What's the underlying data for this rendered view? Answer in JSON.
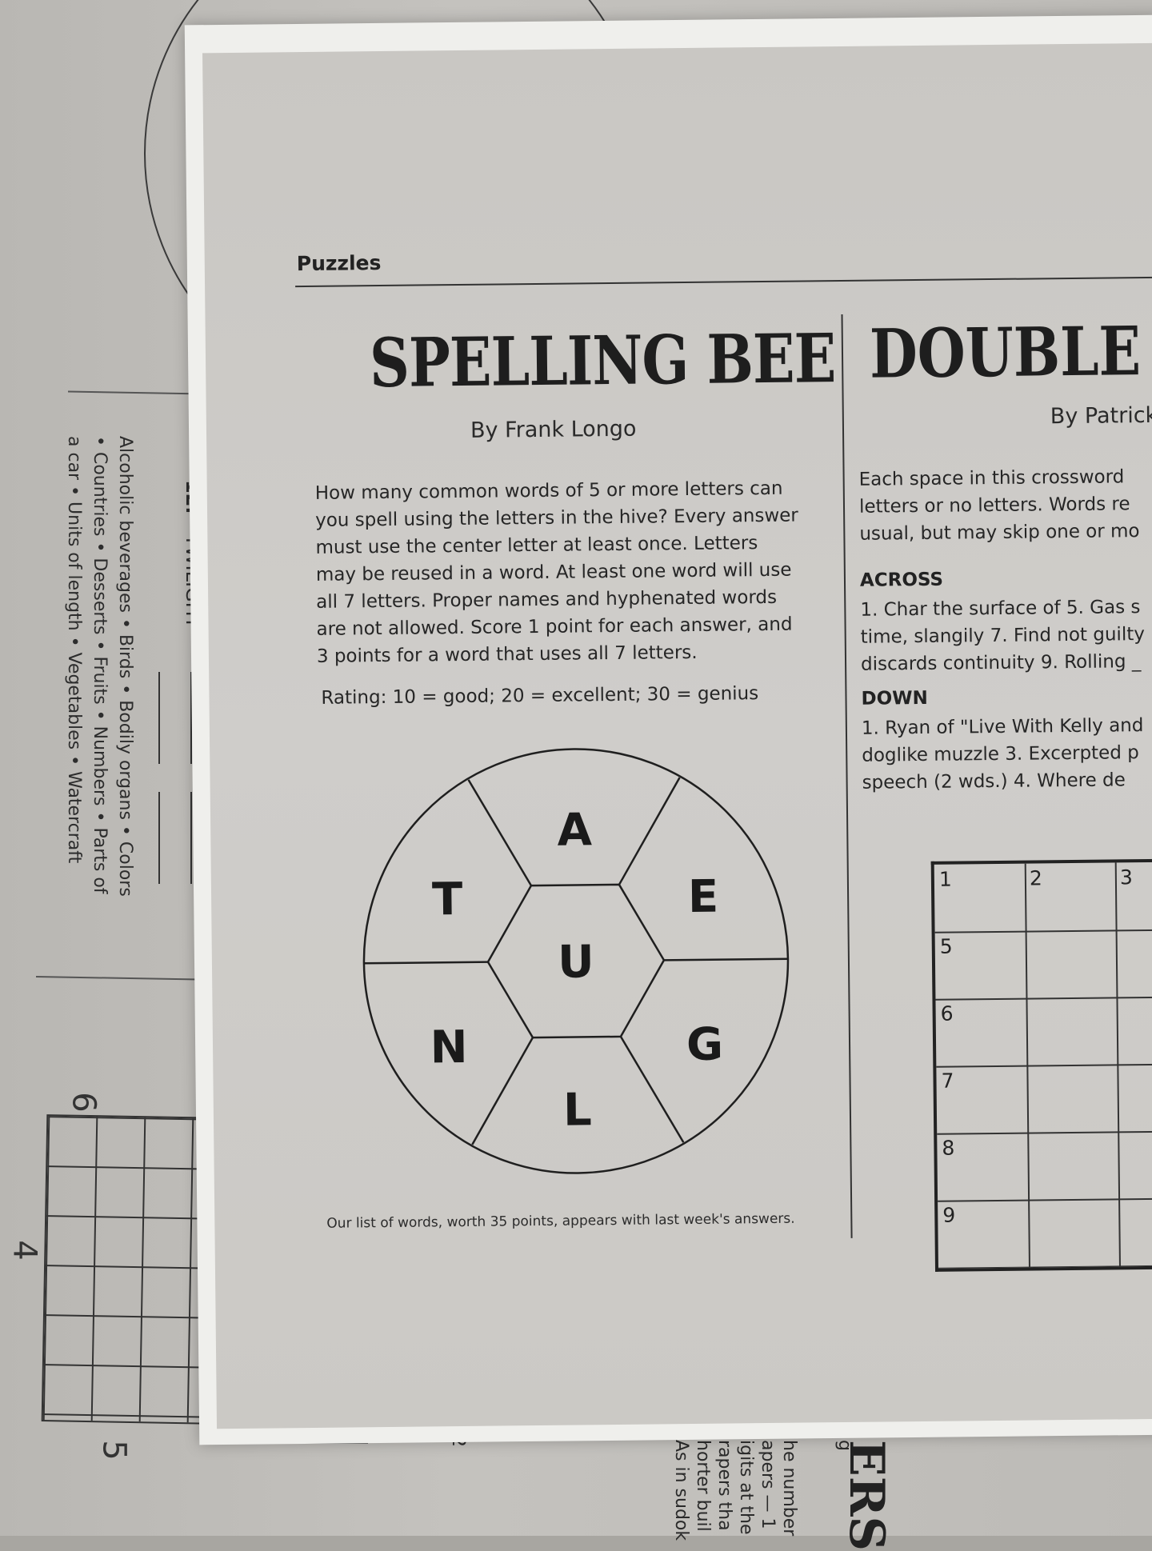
{
  "background_page": {
    "item_number": "12.",
    "item_word": "TWILIGHT",
    "categories_lines": [
      "Alcoholic beverages • Birds • Bodily organs • Colors",
      "• Countries • Desserts • Fruits • Numbers • Parts of",
      "a car • Units of length • Vegetables • Watercraft"
    ],
    "grid_numbers": [
      "6",
      "4",
      "5"
    ],
    "bottom_fragments": [
      "2",
      "g"
    ],
    "bottom_right_lines": [
      "he number",
      "apers — 1",
      "igits at the",
      "rapers tha",
      "horter buil",
      "As in sudok"
    ],
    "bottom_title_fragment": "ERS"
  },
  "sheet": {
    "section_label": "Puzzles",
    "spelling_bee": {
      "title": "SPELLING BEE",
      "byline": "By Frank Longo",
      "instructions": "How many common words of 5 or more letters can you spell using the letters in the hive? Every answer must use the center letter at least once. Letters may be reused in a word. At least one word will use all 7 letters. Proper names and hyphenated words are not allowed. Score 1 point for each answer, and 3 points for a word that uses all 7 letters.",
      "rating": "Rating: 10 = good; 20 = excellent; 30 = genius",
      "hive": {
        "center": "U",
        "outer": [
          "A",
          "E",
          "G",
          "L",
          "N",
          "T"
        ]
      },
      "footer": "Our list of words, worth 35 points, appears with last week's answers."
    },
    "double_or": {
      "title": "DOUBLE OR",
      "byline": "By Patrick",
      "intro_lines": [
        "Each space in this crossword",
        "letters or no letters. Words re",
        "usual, but may skip one or mo"
      ],
      "across_heading": "ACROSS",
      "across_lines": [
        "1. Char the surface of 5. Gas s",
        "time, slangily 7. Find not guilty",
        "discards continuity 9. Rolling _"
      ],
      "down_heading": "DOWN",
      "down_lines": [
        "1. Ryan of \"Live With Kelly and",
        "doglike muzzle 3. Excerpted p",
        "speech (2 wds.) 4. Where de"
      ],
      "grid_numbers": [
        "1",
        "2",
        "3",
        "5",
        "6",
        "7",
        "8",
        "9"
      ]
    }
  }
}
